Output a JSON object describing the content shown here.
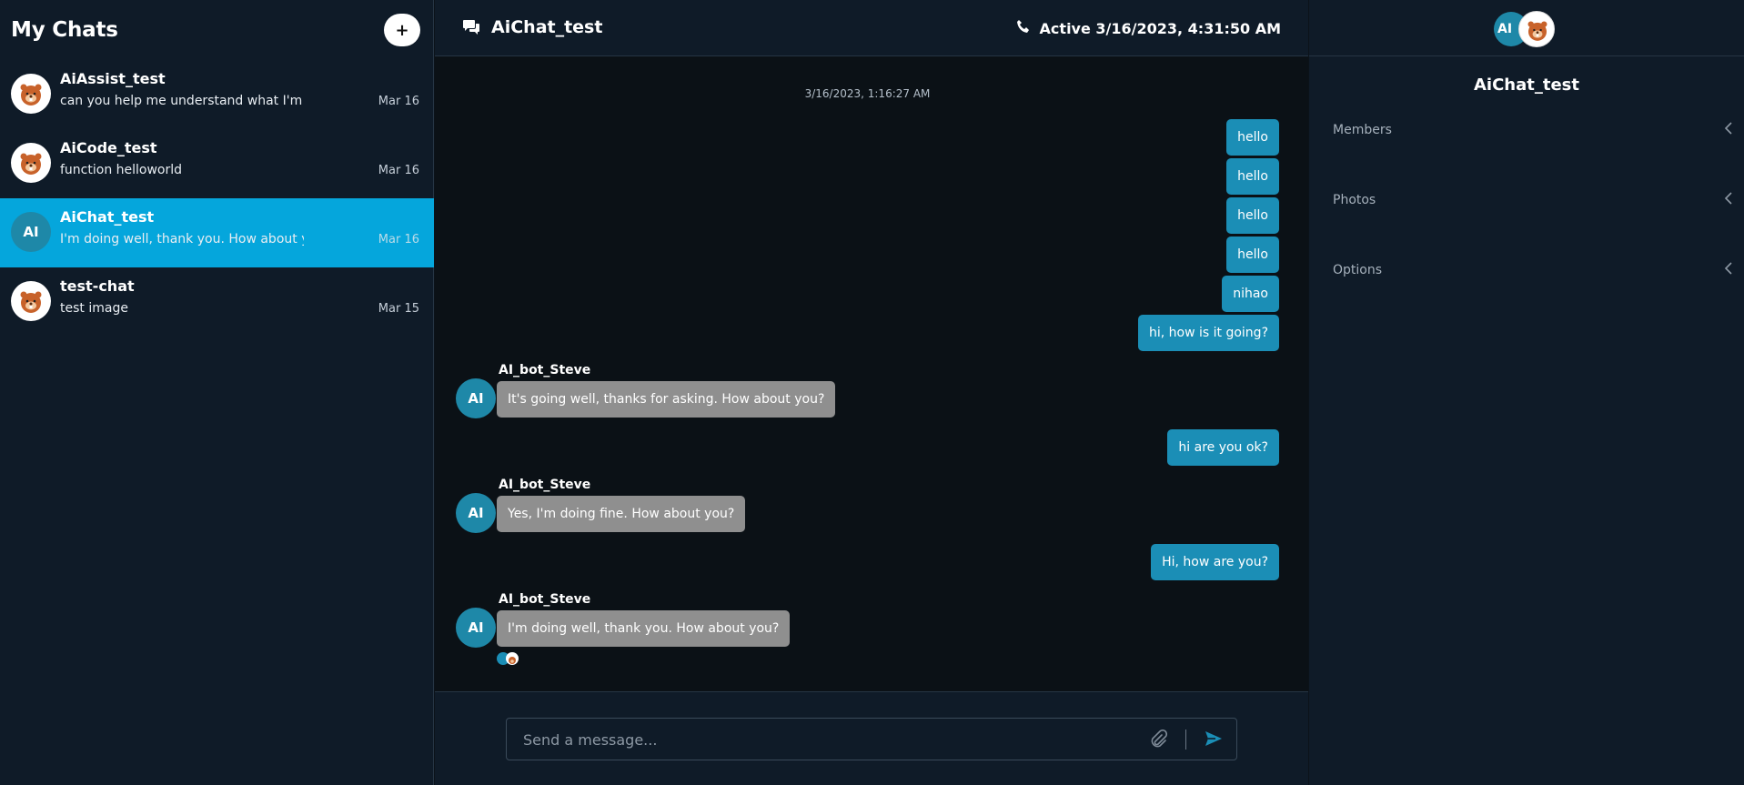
{
  "sidebar": {
    "title": "My Chats",
    "add_button": "+",
    "chats": [
      {
        "name": "AiAssist_test",
        "preview": "can you help me understand what I'm going to do",
        "date": "Mar 16",
        "avatar": "beaver"
      },
      {
        "name": "AiCode_test",
        "preview": "function helloworld",
        "date": "Mar 16",
        "avatar": "beaver"
      },
      {
        "name": "AiChat_test",
        "preview": "I'm doing well, thank you. How about you?",
        "date": "Mar 16",
        "avatar": "AI",
        "active": true
      },
      {
        "name": "test-chat",
        "preview": "test image",
        "date": "Mar 15",
        "avatar": "beaver"
      }
    ]
  },
  "header": {
    "title": "AiChat_test",
    "status": "Active 3/16/2023, 4:31:50 AM"
  },
  "messages": {
    "timestamp": "3/16/2023, 1:16:27 AM",
    "outgoing": [
      "hello",
      "hello",
      "hello",
      "hello",
      "nihao",
      "hi, how is it going?",
      "hi are you ok?",
      "Hi, how are you?"
    ],
    "incoming": [
      {
        "sender": "AI_bot_Steve",
        "avatar": "AI",
        "text": "It's going well, thanks for asking. How about you?"
      },
      {
        "sender": "AI_bot_Steve",
        "avatar": "AI",
        "text": "Yes, I'm doing fine. How about you?"
      },
      {
        "sender": "AI_bot_Steve",
        "avatar": "AI",
        "text": "I'm doing well, thank you. How about you?"
      }
    ]
  },
  "composer": {
    "placeholder": "Send a message..."
  },
  "details": {
    "avatar_label": "AI",
    "title": "AiChat_test",
    "sections": [
      "Members",
      "Photos",
      "Options"
    ]
  },
  "colors": {
    "accent": "#05a6dc",
    "outgoing_bubble": "#1b8eb6",
    "incoming_bubble": "#8f8f8f",
    "panel_bg": "#0f1b28"
  }
}
